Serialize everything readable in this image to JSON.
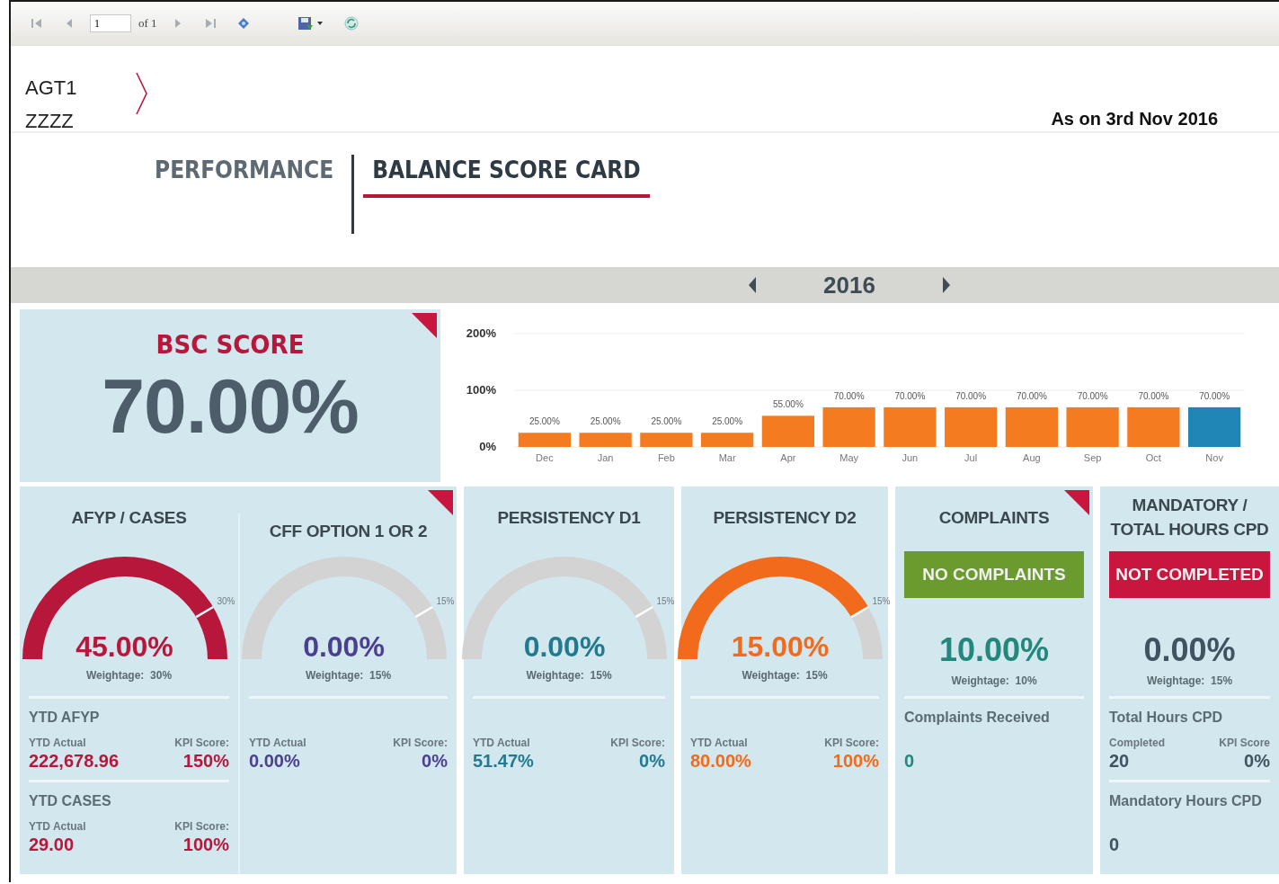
{
  "toolbar": {
    "page_input": "1",
    "page_count": "of 1"
  },
  "header": {
    "agent_code": "AGT1",
    "agent_name": "ZZZZ",
    "as_of": "As on 3rd Nov 2016"
  },
  "tabs": [
    {
      "label": "PERFORMANCE",
      "selected": false
    },
    {
      "label": "BALANCE SCORE CARD",
      "selected": true
    }
  ],
  "year_bar": {
    "year": "2016"
  },
  "bsc": {
    "title": "BSC SCORE",
    "value": "70.00%",
    "flagged": true,
    "chart_data": {
      "type": "bar",
      "categories": [
        "Dec",
        "Jan",
        "Feb",
        "Mar",
        "Apr",
        "May",
        "Jun",
        "Jul",
        "Aug",
        "Sep",
        "Oct",
        "Nov"
      ],
      "series": [
        {
          "color": "#f47b20",
          "values": [
            25,
            25,
            25,
            25,
            55,
            70,
            70,
            70,
            70,
            70,
            70,
            null
          ]
        },
        {
          "color": "#1f86b5",
          "values": [
            null,
            null,
            null,
            null,
            null,
            null,
            null,
            null,
            null,
            null,
            null,
            70
          ]
        }
      ],
      "stacked": true,
      "ylim": [
        0,
        200
      ],
      "yticks": [
        {
          "value": 0,
          "label": "0%"
        },
        {
          "value": 100,
          "label": "100%"
        },
        {
          "value": 200,
          "label": "200%"
        }
      ],
      "value_labels": [
        "25.00%",
        "25.00%",
        "25.00%",
        "25.00%",
        "55.00%",
        "70.00%",
        "70.00%",
        "70.00%",
        "70.00%",
        "70.00%",
        "70.00%",
        "70.00%"
      ]
    }
  },
  "kpi_groups": [
    {
      "flagged": true,
      "cards": [
        {
          "kind": "gauge",
          "title": "AFYP / CASES",
          "color": "#b8173c",
          "target_met": true,
          "target_exceeded": true,
          "target_label": "30%",
          "value": "45.00%",
          "weightage": "Weightage:  30%",
          "details": [
            {
              "heading": "YTD AFYP",
              "left_label": "YTD Actual",
              "left_value": "222,678.96",
              "right_label": "KPI Score:",
              "right_value": "150%"
            },
            {
              "heading": "YTD CASES",
              "left_label": "YTD Actual",
              "left_value": "29.00",
              "right_label": "KPI Score:",
              "right_value": "100%"
            }
          ]
        },
        {
          "kind": "gauge",
          "title": "CFF OPTION 1 OR 2",
          "color": "#4b3f8f",
          "target_met": false,
          "target_exceeded": false,
          "target_label": "15%",
          "value": "0.00%",
          "weightage": "Weightage:  15%",
          "details": [
            {
              "left_label": "YTD Actual",
              "left_value": "0.00%",
              "right_label": "KPI Score:",
              "right_value": "0%"
            }
          ]
        }
      ]
    },
    {
      "flagged": false,
      "cards": [
        {
          "kind": "gauge",
          "title": "PERSISTENCY D1",
          "color": "#23798e",
          "target_met": false,
          "target_exceeded": false,
          "target_label": "15%",
          "value": "0.00%",
          "weightage": "Weightage:  15%",
          "details": [
            {
              "left_label": "YTD Actual",
              "left_value": "51.47%",
              "right_label": "KPI Score:",
              "right_value": "0%"
            }
          ]
        }
      ]
    },
    {
      "flagged": false,
      "cards": [
        {
          "kind": "gauge",
          "title": "PERSISTENCY D2",
          "color": "#f26a1b",
          "target_met": true,
          "target_exceeded": false,
          "target_label": "15%",
          "value": "15.00%",
          "weightage": "Weightage:  15%",
          "details": [
            {
              "left_label": "YTD Actual",
              "left_value": "80.00%",
              "right_label": "KPI Score:",
              "right_value": "100%"
            }
          ]
        }
      ]
    },
    {
      "flagged": true,
      "cards": [
        {
          "kind": "status",
          "title": "COMPLAINTS",
          "status": {
            "label": "NO COMPLAINTS",
            "color": "#6b9a2f"
          },
          "color": "#22877c",
          "value": "10.00%",
          "weightage": "Weightage:  10%",
          "details": [
            {
              "heading": "Complaints Received",
              "left_value": "0"
            }
          ]
        }
      ]
    },
    {
      "flagged": false,
      "cards": [
        {
          "kind": "status",
          "title": "MANDATORY / TOTAL HOURS CPD",
          "status": {
            "label": "NOT COMPLETED",
            "color": "#c8163f"
          },
          "color": "#3f5360",
          "value": "0.00%",
          "weightage": "Weightage:  15%",
          "details": [
            {
              "heading": "Total Hours CPD",
              "left_label": "Completed",
              "left_value": "20",
              "right_label": "KPI Score",
              "right_value": "0%"
            },
            {
              "heading": "Mandatory Hours CPD",
              "left_value": "0"
            }
          ]
        }
      ]
    }
  ]
}
